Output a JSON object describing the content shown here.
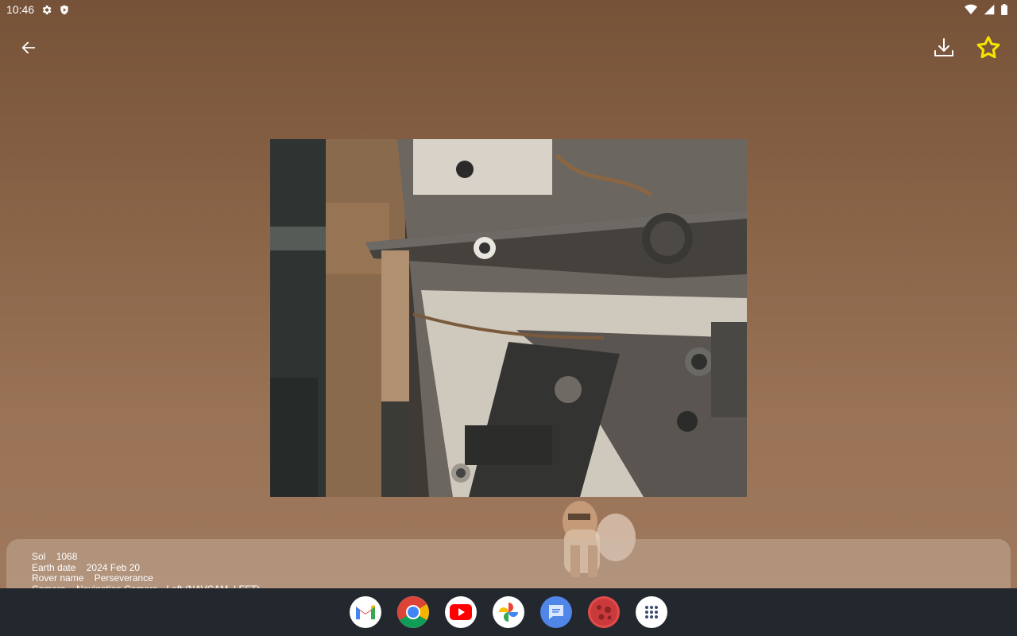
{
  "status_bar": {
    "time": "10:46",
    "left_icons": [
      "settings-icon",
      "shield-icon"
    ],
    "right_icons": [
      "wifi-icon",
      "cellular-signal-icon",
      "battery-icon"
    ]
  },
  "toolbar": {
    "back_icon": "arrow-back-icon",
    "download_icon": "download-icon",
    "favorite_icon": "star-icon",
    "favorite_color": "#f5e400"
  },
  "photo_info": {
    "sol_label": "Sol",
    "sol_value": "1068",
    "earth_date_label": "Earth date",
    "earth_date_value": "2024 Feb 20",
    "rover_label": "Rover name",
    "rover_value": "Perseverance",
    "camera_label": "Camera",
    "camera_value": "Navigation Camera - Left (NAVCAM_LEFT)"
  },
  "taskbar": {
    "apps": [
      "Gmail",
      "Chrome",
      "YouTube",
      "Photos",
      "Messages",
      "Mars Rover Photos",
      "App drawer"
    ]
  }
}
